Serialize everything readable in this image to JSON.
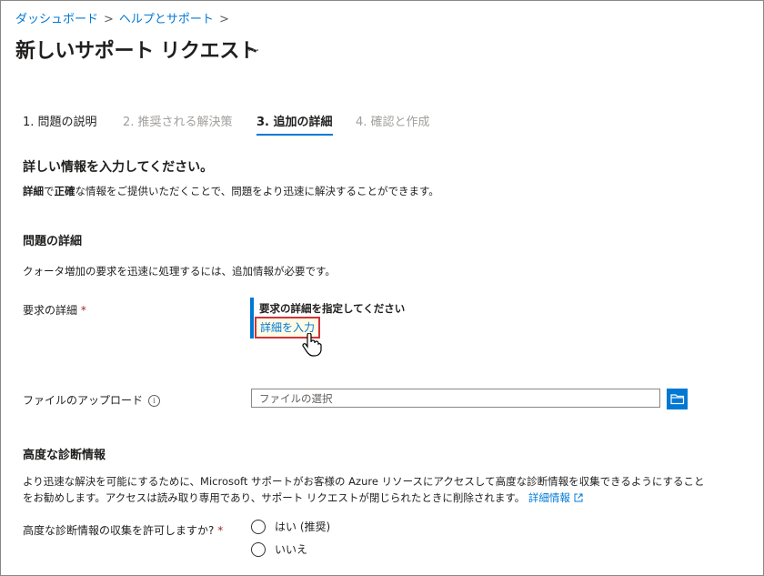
{
  "breadcrumb": [
    "ダッシュボード",
    "ヘルプとサポート"
  ],
  "breadcrumb_sep": ">",
  "page_title": "新しいサポート リクエスト",
  "more_label": "...",
  "tabs": [
    {
      "label": "1. 問題の説明",
      "state": "done"
    },
    {
      "label": "2. 推奨される解決策",
      "state": "disabled"
    },
    {
      "label": "3. 追加の詳細",
      "state": "active"
    },
    {
      "label": "4. 確認と作成",
      "state": "disabled"
    }
  ],
  "main_heading": "詳しい情報を入力してください。",
  "intro": {
    "bold1": "詳細",
    "part1": "で",
    "bold2": "正確",
    "part2": "な情報をご提供いただくことで、問題をより迅速に解決することができます。"
  },
  "problem_details": {
    "heading": "問題の詳細",
    "description": "クォータ増加の要求を迅速に処理するには、追加情報が必要です。",
    "request_label": "要求の詳細",
    "required_mark": "*",
    "request_box_title": "要求の詳細を指定してください",
    "request_box_link": "詳細を入力",
    "file_upload_label": "ファイルのアップロード",
    "info_icon": "i",
    "file_placeholder": "ファイルの選択"
  },
  "advanced": {
    "heading": "高度な診断情報",
    "line1": "より迅速な解決を可能にするために、Microsoft サポートがお客様の Azure リソースにアクセスして高度な診断情報を収集できるようにすること",
    "line2": "をお勧めします。アクセスは読み取り専用であり、サポート リクエストが閉じられたときに削除されます。",
    "link": "詳細情報",
    "question": "高度な診断情報の収集を許可しますか?",
    "required_mark": "*",
    "options": [
      "はい (推奨)",
      "いいえ"
    ]
  },
  "colors": {
    "accent": "#0078d4",
    "required": "#a4262c",
    "highlight": "#d13438"
  }
}
